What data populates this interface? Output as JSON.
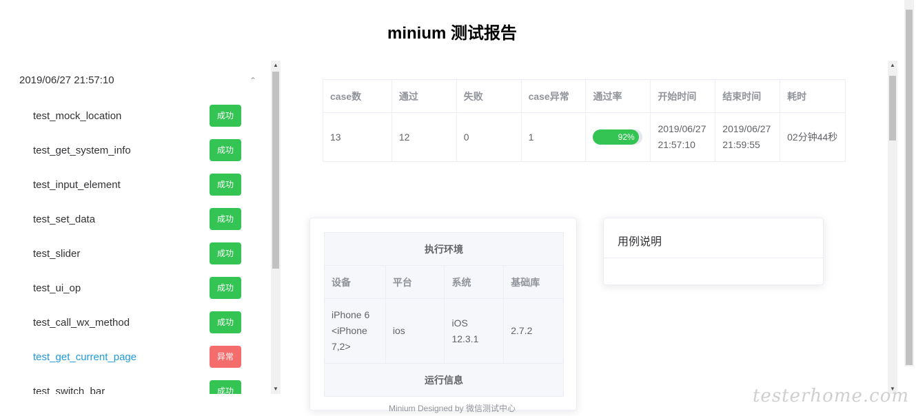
{
  "title": "minium 测试报告",
  "sidebar": {
    "group_time": "2019/06/27 21:57:10",
    "cases": [
      {
        "name": "test_mock_location",
        "status": "成功",
        "state": "ok"
      },
      {
        "name": "test_get_system_info",
        "status": "成功",
        "state": "ok"
      },
      {
        "name": "test_input_element",
        "status": "成功",
        "state": "ok"
      },
      {
        "name": "test_set_data",
        "status": "成功",
        "state": "ok"
      },
      {
        "name": "test_slider",
        "status": "成功",
        "state": "ok"
      },
      {
        "name": "test_ui_op",
        "status": "成功",
        "state": "ok"
      },
      {
        "name": "test_call_wx_method",
        "status": "成功",
        "state": "ok"
      },
      {
        "name": "test_get_current_page",
        "status": "异常",
        "state": "err"
      },
      {
        "name": "test_switch_bar",
        "status": "成功",
        "state": "ok"
      }
    ]
  },
  "stats": {
    "headers": [
      "case数",
      "通过",
      "失败",
      "case异常",
      "通过率",
      "开始时间",
      "结束时间",
      "耗时"
    ],
    "row": {
      "cases": "13",
      "passed": "12",
      "failed": "0",
      "errors": "1",
      "rate_label": "92%",
      "rate_fraction": 0.92,
      "start_time": "2019/06/27 21:57:10",
      "end_time": "2019/06/27 21:59:55",
      "duration": "02分钟44秒"
    }
  },
  "env": {
    "section_title": "执行环境",
    "headers": [
      "设备",
      "平台",
      "系统",
      "基础库"
    ],
    "values": [
      "iPhone 6 <iPhone 7,2>",
      "ios",
      "iOS 12.3.1",
      "2.7.2"
    ],
    "run_section_title": "运行信息"
  },
  "description": {
    "title": "用例说明"
  },
  "footer": "Minium Designed by 微信测试中心",
  "watermark": "testerhome.com",
  "colors": {
    "success": "#34c453",
    "error": "#f56c6c",
    "active_link": "#1e9bdc"
  }
}
